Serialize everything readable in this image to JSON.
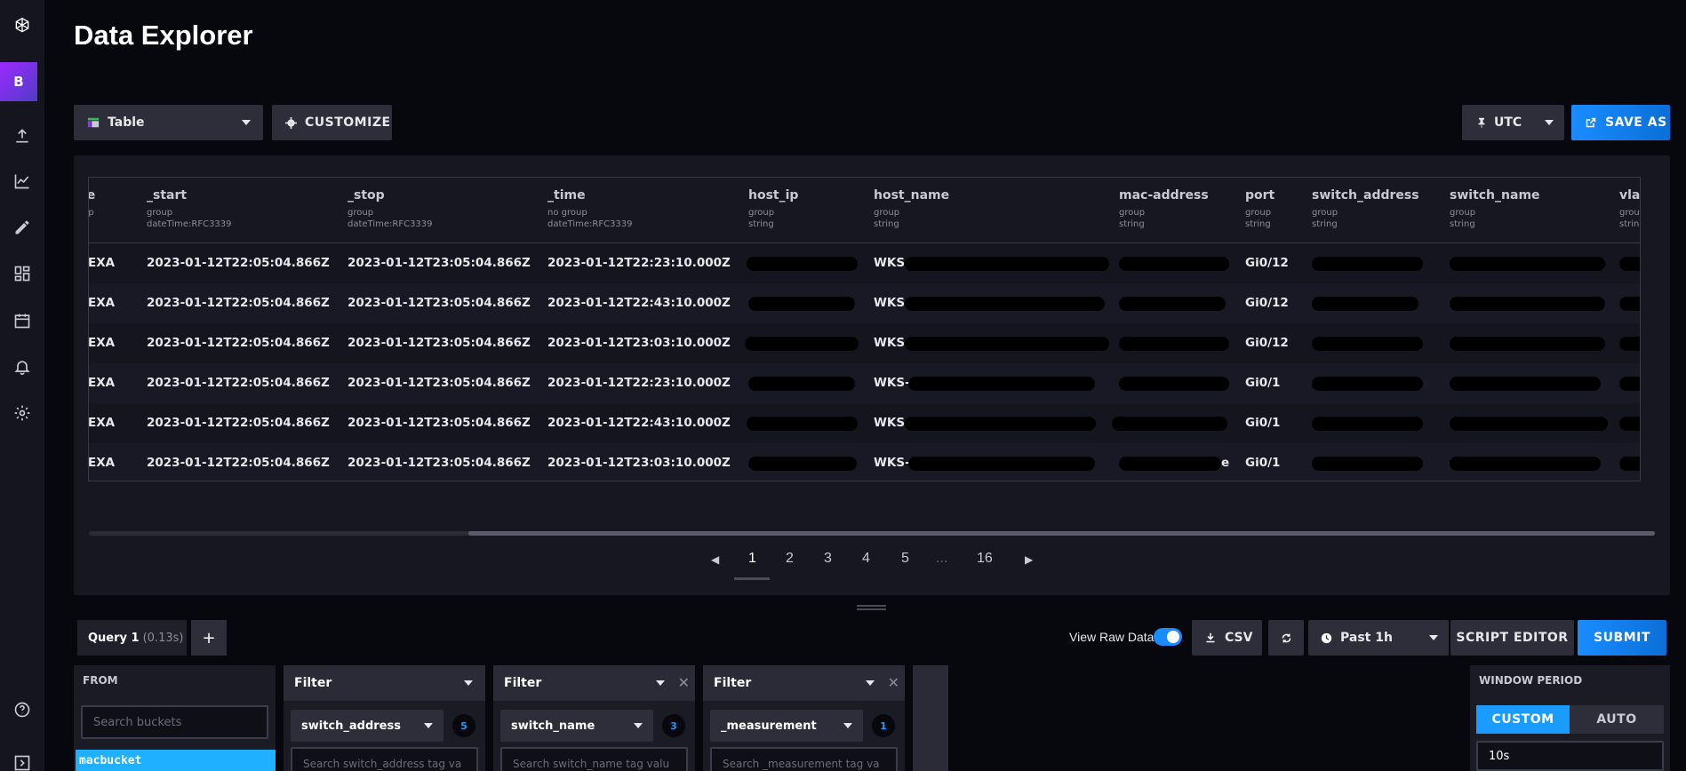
{
  "page": {
    "title": "Data Explorer"
  },
  "nav": {
    "org_initial": "B",
    "icons": [
      "influx-logo-icon",
      "upload-icon",
      "graph-icon",
      "pencil-icon",
      "dashboards-icon",
      "calendar-icon",
      "bell-icon",
      "gear-icon",
      "help-icon",
      "expand-icon"
    ]
  },
  "toolbar": {
    "vis_type": "Table",
    "customize_label": "CUSTOMIZE",
    "timezone": "UTC",
    "save_as_label": "SAVE AS"
  },
  "table": {
    "columns": [
      {
        "name": "lue",
        "group": "roup",
        "type": "ng"
      },
      {
        "name": "_start",
        "group": "group",
        "type": "dateTime:RFC3339"
      },
      {
        "name": "_stop",
        "group": "group",
        "type": "dateTime:RFC3339"
      },
      {
        "name": "_time",
        "group": "no group",
        "type": "dateTime:RFC3339"
      },
      {
        "name": "host_ip",
        "group": "group",
        "type": "string"
      },
      {
        "name": "host_name",
        "group": "group",
        "type": "string"
      },
      {
        "name": "mac-address",
        "group": "group",
        "type": "string"
      },
      {
        "name": "port",
        "group": "group",
        "type": "string"
      },
      {
        "name": "switch_address",
        "group": "group",
        "type": "string"
      },
      {
        "name": "switch_name",
        "group": "group",
        "type": "string"
      },
      {
        "name": "vlan",
        "group": "group",
        "type": "string"
      }
    ],
    "rows": [
      {
        "value": "EXA",
        "start": "2023-01-12T22:05:04.866Z",
        "stop": "2023-01-12T23:05:04.866Z",
        "time": "2023-01-12T22:23:10.000Z",
        "host_name": "WKS-",
        "mac": "",
        "port": "Gi0/12"
      },
      {
        "value": "EXA",
        "start": "2023-01-12T22:05:04.866Z",
        "stop": "2023-01-12T23:05:04.866Z",
        "time": "2023-01-12T22:43:10.000Z",
        "host_name": "WKS",
        "mac": "",
        "port": "Gi0/12"
      },
      {
        "value": "EXA",
        "start": "2023-01-12T22:05:04.866Z",
        "stop": "2023-01-12T23:05:04.866Z",
        "time": "2023-01-12T23:03:10.000Z",
        "host_name": "WKS",
        "mac": "",
        "port": "Gi0/12"
      },
      {
        "value": "EXA",
        "start": "2023-01-12T22:05:04.866Z",
        "stop": "2023-01-12T23:05:04.866Z",
        "time": "2023-01-12T22:23:10.000Z",
        "host_name": "WKS-",
        "mac": "",
        "port": "Gi0/1"
      },
      {
        "value": "EXA",
        "start": "2023-01-12T22:05:04.866Z",
        "stop": "2023-01-12T23:05:04.866Z",
        "time": "2023-01-12T22:43:10.000Z",
        "host_name": "WKS",
        "mac": "",
        "port": "Gi0/1"
      },
      {
        "value": "EXA",
        "start": "2023-01-12T22:05:04.866Z",
        "stop": "2023-01-12T23:05:04.866Z",
        "time": "2023-01-12T23:03:10.000Z",
        "host_name": "WKS-",
        "mac": "e",
        "port": "Gi0/1"
      }
    ]
  },
  "pagination": {
    "pages": [
      "1",
      "2",
      "3",
      "4",
      "5",
      "...",
      "16"
    ],
    "current": "1"
  },
  "query_bar": {
    "tab_label": "Query 1",
    "tab_time": "(0.13s)",
    "add_label": "+",
    "raw_data_label": "View Raw Data",
    "raw_data_on": true,
    "csv_label": "CSV",
    "time_range": "Past 1h",
    "script_editor_label": "SCRIPT EDITOR",
    "submit_label": "SUBMIT"
  },
  "builder": {
    "from": {
      "title": "FROM",
      "search_placeholder": "Search buckets",
      "selected_bucket": "macbucket"
    },
    "filters": [
      {
        "title": "Filter",
        "key": "switch_address",
        "count": "5",
        "search_placeholder": "Search switch_address tag va"
      },
      {
        "title": "Filter",
        "key": "switch_name",
        "count": "3",
        "search_placeholder": "Search switch_name tag valu"
      },
      {
        "title": "Filter",
        "key": "_measurement",
        "count": "1",
        "search_placeholder": "Search _measurement tag va"
      }
    ],
    "window_period": {
      "title": "WINDOW PERIOD",
      "custom_label": "CUSTOM",
      "auto_label": "AUTO",
      "value": "10s"
    }
  },
  "colors": {
    "accent": "#1a8cff",
    "org": "#9b2aff",
    "background": "#07070e",
    "panel": "#161721"
  }
}
